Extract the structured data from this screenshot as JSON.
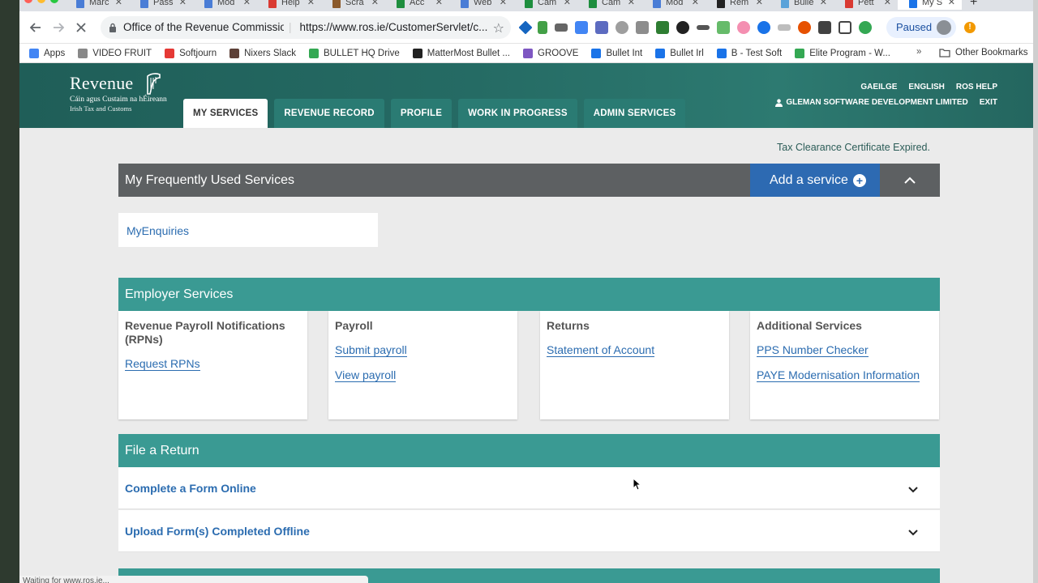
{
  "browser": {
    "tabs": [
      {
        "label": "Marc",
        "color": "#4a7dd6"
      },
      {
        "label": "Pass",
        "color": "#4a7dd6"
      },
      {
        "label": "Mod",
        "color": "#4a7dd6"
      },
      {
        "label": "Help",
        "color": "#d93a32"
      },
      {
        "label": "Scra",
        "color": "#8b5a2b"
      },
      {
        "label": "Acc",
        "color": "#1e8e3e"
      },
      {
        "label": "Web",
        "color": "#4a7dd6"
      },
      {
        "label": "Cam",
        "color": "#1e8e3e"
      },
      {
        "label": "Cam",
        "color": "#1e8e3e"
      },
      {
        "label": "Mod",
        "color": "#4a7dd6"
      },
      {
        "label": "Rem",
        "color": "#222222"
      },
      {
        "label": "Bulle",
        "color": "#5ba3d9"
      },
      {
        "label": "Pett",
        "color": "#d93a32"
      },
      {
        "label": "My S",
        "color": "#1a73e8"
      }
    ],
    "new_tab": "+",
    "site_name": "Office of the Revenue Commissioners",
    "url": "https://www.ros.ie/CustomerServlet/c...",
    "profile_status": "Paused",
    "bookmarks": [
      "Apps",
      "VIDEO FRUIT",
      "Softjourn",
      "Nixers Slack",
      "BULLET HQ Drive",
      "MatterMost Bullet ...",
      "GROOVE",
      "Bullet Int",
      "Bullet Irl",
      "B - Test Soft",
      "Elite Program - W..."
    ],
    "bookmarks_more": "»",
    "other_bookmarks": "Other Bookmarks",
    "status_text": "Waiting for www.ros.ie..."
  },
  "header": {
    "logo_brand": "Revenue",
    "logo_sub1": "Cáin agus Custaim na hÉireann",
    "logo_sub2": "Irish Tax and Customs",
    "nav": [
      "MY SERVICES",
      "REVENUE RECORD",
      "PROFILE",
      "WORK IN PROGRESS",
      "ADMIN SERVICES"
    ],
    "util_links": [
      "GAEILGE",
      "ENGLISH",
      "ROS HELP"
    ],
    "user_name": "GLEMAN SOFTWARE DEVELOPMENT LIMITED",
    "exit": "EXIT"
  },
  "main": {
    "notice": "Tax Clearance Certificate Expired.",
    "frequent_title": "My Frequently Used Services",
    "add_service": "Add a service",
    "frequent_link": "MyEnquiries",
    "employer_title": "Employer Services",
    "cards": [
      {
        "title": "Revenue Payroll Notifications (RPNs)",
        "links": [
          "Request RPNs"
        ]
      },
      {
        "title": "Payroll",
        "links": [
          "Submit payroll",
          "View payroll"
        ]
      },
      {
        "title": "Returns",
        "links": [
          "Statement of Account"
        ]
      },
      {
        "title": "Additional Services",
        "links": [
          "PPS Number Checker",
          "PAYE Modernisation Information"
        ]
      }
    ],
    "file_return_title": "File a Return",
    "return_rows": [
      "Complete a Form Online",
      "Upload Form(s) Completed Offline"
    ]
  },
  "colors": {
    "header_teal": "#21625b",
    "section_teal": "#3a9a93",
    "link_blue": "#2b6cb0",
    "add_button_blue": "#2d6ab2",
    "freq_bar_grey": "#5d6062"
  }
}
